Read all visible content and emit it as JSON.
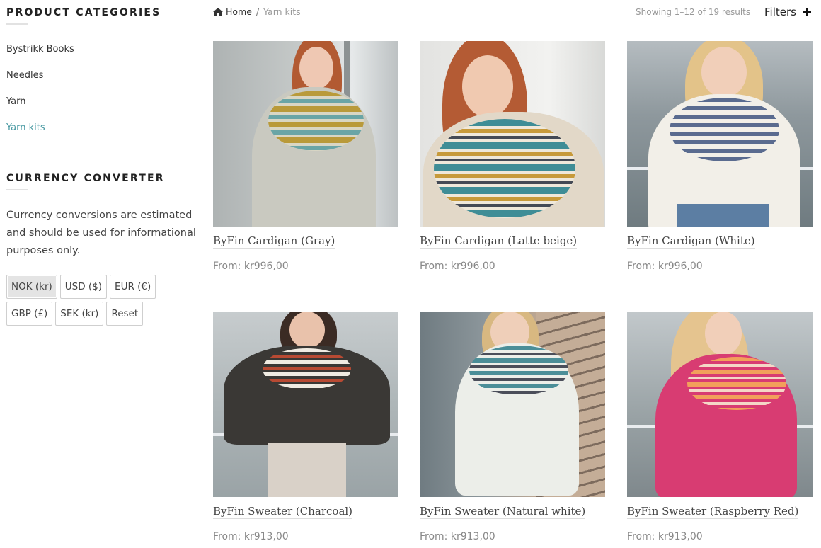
{
  "sidebar": {
    "categories_title": "PRODUCT CATEGORIES",
    "categories": [
      {
        "label": "Bystrikk Books",
        "active": false
      },
      {
        "label": "Needles",
        "active": false
      },
      {
        "label": "Yarn",
        "active": false
      },
      {
        "label": "Yarn kits",
        "active": true
      }
    ],
    "currency_title": "CURRENCY CONVERTER",
    "currency_note": "Currency conversions are estimated and should be used for informational purposes only.",
    "currency_buttons": [
      {
        "label": "NOK (kr)",
        "active": true
      },
      {
        "label": "USD ($)",
        "active": false
      },
      {
        "label": "EUR (€)",
        "active": false
      },
      {
        "label": "GBP (£)",
        "active": false
      },
      {
        "label": "SEK (kr)",
        "active": false
      },
      {
        "label": "Reset",
        "active": false
      }
    ]
  },
  "breadcrumb": {
    "home": "Home",
    "separator": "/",
    "current": "Yarn kits"
  },
  "toolbar": {
    "results": "Showing 1–12 of 19 results",
    "filters_label": "Filters"
  },
  "products": [
    {
      "name": "ByFin Cardigan (Gray)",
      "price": "From: kr996,00"
    },
    {
      "name": "ByFin Cardigan (Latte beige)",
      "price": "From: kr996,00"
    },
    {
      "name": "ByFin Cardigan (White)",
      "price": "From: kr996,00"
    },
    {
      "name": "ByFin Sweater (Charcoal)",
      "price": "From: kr913,00"
    },
    {
      "name": "ByFin Sweater (Natural white)",
      "price": "From: kr913,00"
    },
    {
      "name": "ByFin Sweater (Raspberry Red)",
      "price": "From: kr913,00"
    }
  ],
  "colors": {
    "accent": "#4a9aa3",
    "text": "#333333",
    "muted": "#999999"
  }
}
